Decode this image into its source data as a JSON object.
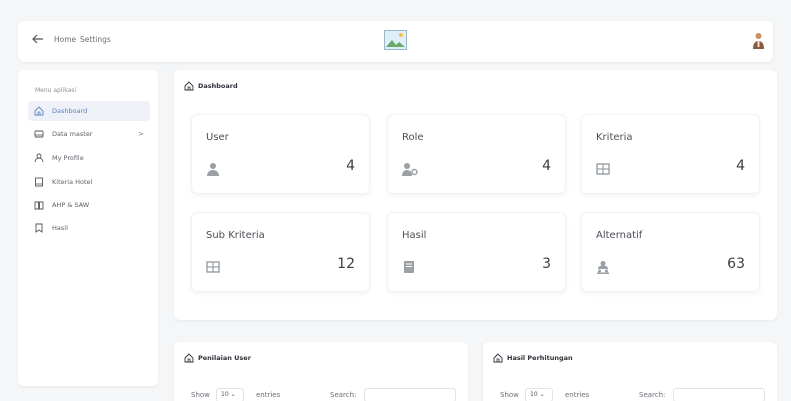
{
  "topbar": {
    "home_label": "Home",
    "settings_label": "Settings"
  },
  "sidebar": {
    "menu_title": "Menu aplikasi",
    "items": [
      {
        "label": "Dashboard",
        "icon": "home-icon"
      },
      {
        "label": "Data master",
        "icon": "drive-icon",
        "chevron": ">"
      },
      {
        "label": "My Profile",
        "icon": "person-icon"
      },
      {
        "label": "Kiteria Hotel",
        "icon": "book-icon"
      },
      {
        "label": "AHP & SAW",
        "icon": "open-book-icon"
      },
      {
        "label": "Hasil",
        "icon": "bookmark-icon"
      }
    ]
  },
  "dashboard": {
    "title": "Dashboard",
    "stats": [
      {
        "label": "User",
        "value": "4",
        "icon": "user-icon"
      },
      {
        "label": "Role",
        "value": "4",
        "icon": "user-gear-icon"
      },
      {
        "label": "Kriteria",
        "value": "4",
        "icon": "table-icon"
      },
      {
        "label": "Sub Kriteria",
        "value": "12",
        "icon": "table-icon"
      },
      {
        "label": "Hasil",
        "value": "3",
        "icon": "book-icon"
      },
      {
        "label": "Alternatif",
        "value": "63",
        "icon": "users-icon"
      }
    ]
  },
  "penilaian": {
    "title": "Penilaian User",
    "show_label": "Show",
    "entries_value": "10",
    "entries_label": "entries",
    "search_label": "Search:"
  },
  "hasil_perhitungan": {
    "title": "Hasil Perhitungan",
    "show_label": "Show",
    "entries_value": "10",
    "entries_label": "entries",
    "search_label": "Search:"
  }
}
